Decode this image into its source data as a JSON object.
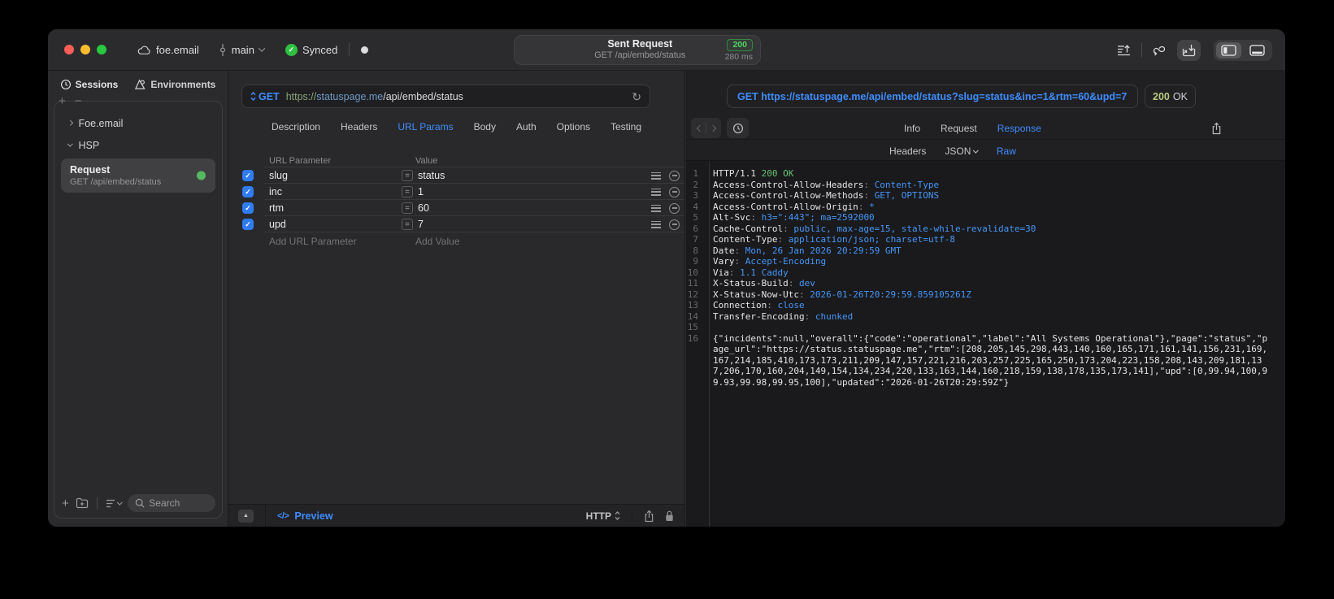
{
  "icons": {
    "plus": "+",
    "minus": "−",
    "triangle_up": "▲",
    "refresh": "↻",
    "check": "✓",
    "equals": "=",
    "code_glyph": "</>"
  },
  "titlebar": {
    "project": "foe.email",
    "branch": "main",
    "sync": "Synced",
    "title": "Sent Request",
    "subtitle": "GET /api/embed/status",
    "status_code": "200",
    "duration": "280 ms"
  },
  "sidebar": {
    "tab_sessions": "Sessions",
    "tab_environments": "Environments",
    "group_project": "Foe.email",
    "group_hsp": "HSP",
    "request": {
      "title": "Request",
      "subtitle": "GET /api/embed/status"
    },
    "search_placeholder": "Search"
  },
  "request_editor": {
    "method": "GET",
    "url": {
      "scheme": "https://",
      "host": "statuspage.me",
      "path": "/api/embed/status"
    },
    "tabs": [
      "Description",
      "Headers",
      "URL Params",
      "Body",
      "Auth",
      "Options",
      "Testing"
    ],
    "active_tab": "URL Params",
    "params": {
      "col_name": "URL Parameter",
      "col_value": "Value",
      "rows": [
        {
          "name": "slug",
          "value": "status",
          "enabled": true
        },
        {
          "name": "inc",
          "value": "1",
          "enabled": true
        },
        {
          "name": "rtm",
          "value": "60",
          "enabled": true
        },
        {
          "name": "upd",
          "value": "7",
          "enabled": true
        }
      ],
      "add_name": "Add URL Parameter",
      "add_value": "Add Value"
    },
    "footer": {
      "preview": "Preview",
      "protocol": "HTTP"
    }
  },
  "response_viewer": {
    "request_line": "GET https://statuspage.me/api/embed/status?slug=status&inc=1&rtm=60&upd=7",
    "status_code": "200",
    "status_text": "OK",
    "tabs": [
      "Info",
      "Request",
      "Response"
    ],
    "active_tab": "Response",
    "subtabs": [
      "Headers",
      "JSON",
      "Raw"
    ],
    "active_subtab": "Raw",
    "code": {
      "status_line": {
        "protocol": "HTTP/1.1",
        "status": "200 OK"
      },
      "headers": [
        [
          "Access-Control-Allow-Headers",
          "Content-Type"
        ],
        [
          "Access-Control-Allow-Methods",
          "GET, OPTIONS"
        ],
        [
          "Access-Control-Allow-Origin",
          "*"
        ],
        [
          "Alt-Svc",
          "h3=\":443\"; ma=2592000"
        ],
        [
          "Cache-Control",
          "public, max-age=15, stale-while-revalidate=30"
        ],
        [
          "Content-Type",
          "application/json; charset=utf-8"
        ],
        [
          "Date",
          "Mon, 26 Jan 2026 20:29:59 GMT"
        ],
        [
          "Vary",
          "Accept-Encoding"
        ],
        [
          "Via",
          "1.1 Caddy"
        ],
        [
          "X-Status-Build",
          "dev"
        ],
        [
          "X-Status-Now-Utc",
          "2026-01-26T20:29:59.859105261Z"
        ],
        [
          "Connection",
          "close"
        ],
        [
          "Transfer-Encoding",
          "chunked"
        ]
      ],
      "body": "{\"incidents\":null,\"overall\":{\"code\":\"operational\",\"label\":\"All Systems Operational\"},\"page\":\"status\",\"page_url\":\"https://status.statuspage.me\",\"rtm\":[208,205,145,298,443,140,160,165,171,161,141,156,231,169,167,214,185,410,173,173,211,209,147,157,221,216,203,257,225,165,250,173,204,223,158,208,143,209,181,137,206,170,160,204,149,154,134,234,220,133,163,144,160,218,159,138,178,135,173,141],\"upd\":[0,99.94,100,99.93,99.98,99.95,100],\"updated\":\"2026-01-26T20:29:59Z\"}"
    }
  }
}
